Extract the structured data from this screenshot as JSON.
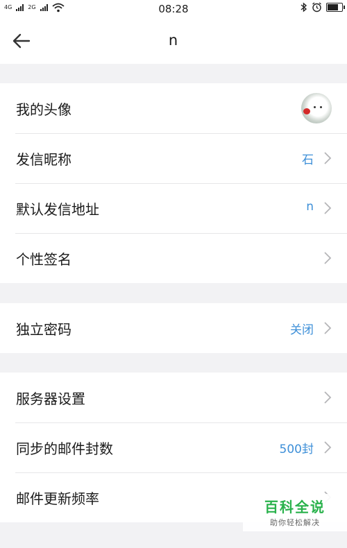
{
  "status_bar": {
    "network_1": "4G",
    "network_2": "2G",
    "time": "08:28"
  },
  "nav": {
    "title": "n"
  },
  "groups": [
    {
      "rows": [
        {
          "label": "我的头像",
          "value": ""
        },
        {
          "label": "发信昵称",
          "value": "石"
        },
        {
          "label": "默认发信地址",
          "value": "n"
        },
        {
          "label": "个性签名",
          "value": ""
        }
      ]
    },
    {
      "rows": [
        {
          "label": "独立密码",
          "value": "关闭"
        }
      ]
    },
    {
      "rows": [
        {
          "label": "服务器设置",
          "value": ""
        },
        {
          "label": "同步的邮件封数",
          "value": "500封"
        },
        {
          "label": "邮件更新频率",
          "value": ""
        }
      ]
    }
  ],
  "watermark": {
    "title": "百科全说",
    "subtitle": "助你轻松解决"
  },
  "colors": {
    "accent": "#3d8fd8",
    "background": "#f2f2f4",
    "watermark_green": "#2ab24c"
  }
}
